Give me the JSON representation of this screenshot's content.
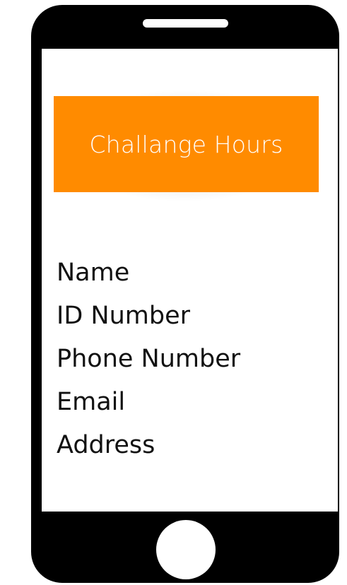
{
  "app": {
    "header_title": "Challange Hours"
  },
  "fields": [
    {
      "label": "Name"
    },
    {
      "label": "ID Number"
    },
    {
      "label": "Phone Number"
    },
    {
      "label": "Email"
    },
    {
      "label": "Address"
    }
  ],
  "colors": {
    "banner": "#ff8b00",
    "phone_frame": "#000000",
    "screen": "#ffffff"
  }
}
